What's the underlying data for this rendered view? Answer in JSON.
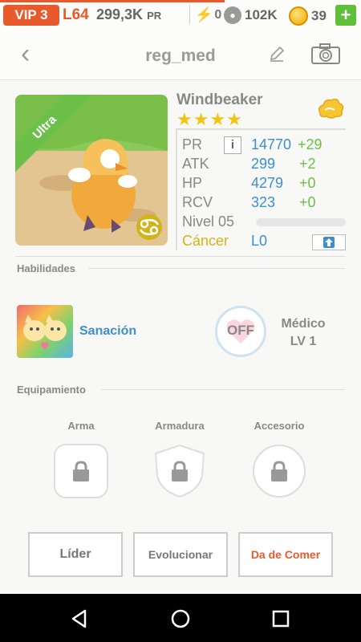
{
  "status": {
    "vip": "VIP 3",
    "level": "L64",
    "pr_value": "299,3K",
    "pr_unit": "PR",
    "stamina": "0",
    "paws": "102K",
    "coins": "39",
    "plus": "+"
  },
  "nav": {
    "title": "reg_med"
  },
  "monster": {
    "rarity": "Ultra",
    "name": "Windbeaker",
    "stars": "★★★★",
    "stats": [
      {
        "label": "PR",
        "value": "14770",
        "add": "+29"
      },
      {
        "label": "ATK",
        "value": "299",
        "add": "+2"
      },
      {
        "label": "HP",
        "value": "4279",
        "add": "+0"
      },
      {
        "label": "RCV",
        "value": "323",
        "add": "+0"
      }
    ],
    "level": "Nivel 05",
    "zodiac": "Cáncer",
    "ascension": "L0",
    "xp_fraction": 0
  },
  "skills": {
    "title": "Habilidades",
    "skill_name": "Sanación",
    "passive_state": "OFF",
    "passive_name": "Médico",
    "passive_level": "LV 1"
  },
  "equipment": {
    "title": "Equipamiento",
    "slots": [
      "Arma",
      "Armadura",
      "Accesorio"
    ]
  },
  "buttons": {
    "leader": "Líder",
    "evolve": "Evolucionar",
    "feed": "Da de Comer"
  },
  "colors": {
    "accent": "#e85a2c",
    "stat_value": "#3a8fd0",
    "stat_add": "#6cc04a",
    "zodiac": "#d2b31b"
  }
}
